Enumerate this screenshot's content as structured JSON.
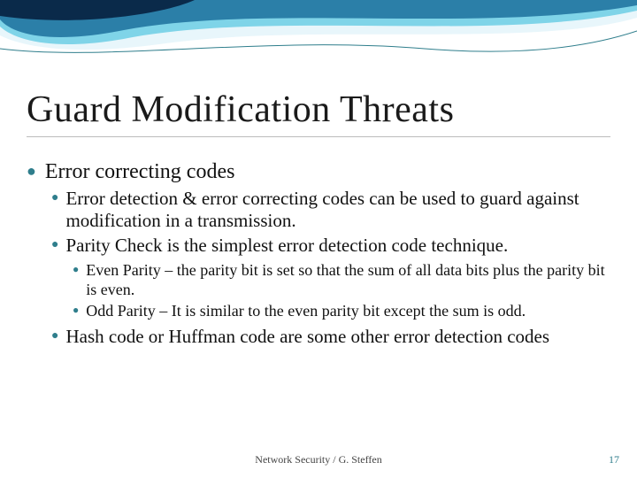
{
  "title": "Guard Modification Threats",
  "bullets": {
    "lvl1": [
      {
        "text": "Error correcting codes",
        "lvl2": [
          {
            "text": "Error detection & error correcting codes can be used to guard against modification in a transmission."
          },
          {
            "text": "Parity Check is the simplest error detection code technique.",
            "lvl3": [
              {
                "text": "Even Parity – the parity bit is set so that the sum of all data bits plus the parity bit is even."
              },
              {
                "text": "Odd Parity – It is similar to the even parity bit except the sum is odd."
              }
            ]
          },
          {
            "text": "Hash code or Huffman code are some other error detection codes"
          }
        ]
      }
    ]
  },
  "footer": {
    "center": "Network Security / G. Steffen",
    "page": "17"
  },
  "colors": {
    "accent": "#2f7e8c",
    "swoosh_dark": "#0a2a4a",
    "swoosh_mid": "#2b7fa8",
    "swoosh_light": "#7fd4e8"
  }
}
